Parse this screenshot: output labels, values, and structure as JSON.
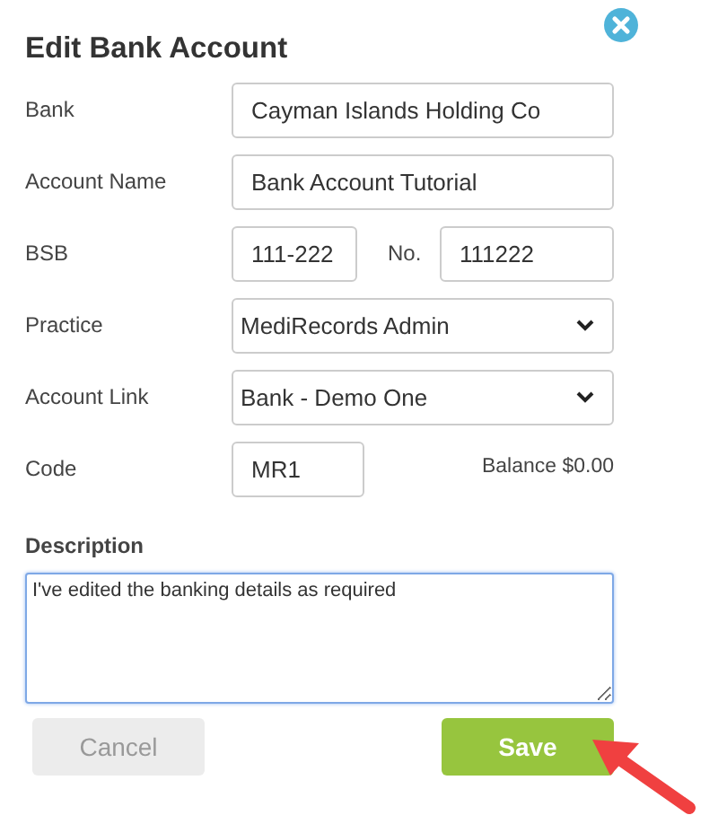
{
  "dialog": {
    "title": "Edit Bank Account"
  },
  "fields": [
    {
      "label": "Bank",
      "kind": "text",
      "value": "Cayman Islands Holding Co"
    },
    {
      "label": "Account Name",
      "kind": "text",
      "value": "Bank Account Tutorial"
    },
    {
      "label": "BSB",
      "kind": "pair",
      "value": "111-222",
      "second_label": "No.",
      "second_value": "111222"
    },
    {
      "label": "Practice",
      "kind": "select",
      "value": "MediRecords Admin"
    },
    {
      "label": "Account Link",
      "kind": "select",
      "value": "Bank - Demo One"
    },
    {
      "label": "Code",
      "kind": "short",
      "value": "MR1",
      "note": "Balance $0.00"
    }
  ],
  "description": {
    "label": "Description",
    "value": "I've edited the banking details as required",
    "focused": true
  },
  "buttons": [
    {
      "label": "Cancel",
      "kind": "secondary"
    },
    {
      "label": "Save",
      "kind": "primary"
    }
  ]
}
